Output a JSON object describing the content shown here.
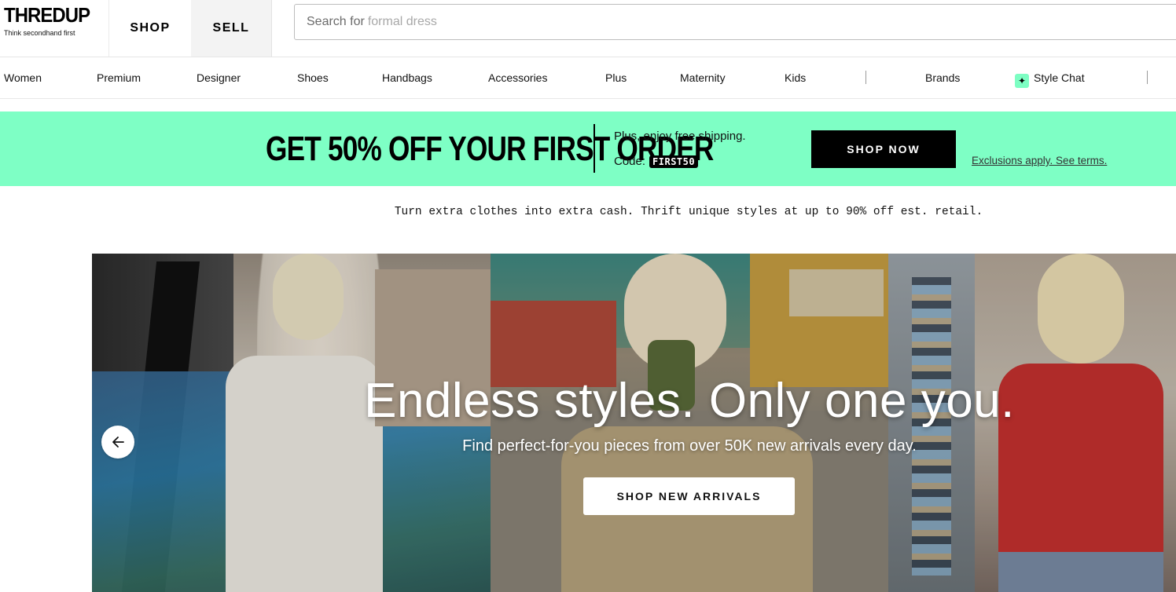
{
  "logo": {
    "word": "THREDUP",
    "tagline": "Think secondhand first"
  },
  "tabs": [
    {
      "label": "SHOP"
    },
    {
      "label": "SELL"
    }
  ],
  "search": {
    "prefix": "Search for",
    "suggestion": "formal dress"
  },
  "categories": [
    {
      "label": "Women"
    },
    {
      "label": "Premium"
    },
    {
      "label": "Designer"
    },
    {
      "label": "Shoes"
    },
    {
      "label": "Handbags"
    },
    {
      "label": "Accessories"
    },
    {
      "label": "Plus"
    },
    {
      "label": "Maternity"
    },
    {
      "label": "Kids"
    },
    {
      "label": "Brands"
    },
    {
      "label": "Style Chat",
      "icon": "sparkle-icon"
    }
  ],
  "promo": {
    "title": "GET 50% OFF YOUR FIRST ORDER",
    "subtitle": "Plus, enjoy free shipping.",
    "code_label": "Code:",
    "code": "FIRST50",
    "cta": "SHOP NOW",
    "terms": "Exclusions apply. See terms.",
    "background": "#7effc5"
  },
  "tagline": "Turn extra clothes into extra cash. Thrift unique styles at up to 90% off est. retail.",
  "hero": {
    "title": "Endless styles. Only one you.",
    "subtitle": "Find perfect-for-you pieces from over 50K new arrivals every day.",
    "cta": "SHOP NEW ARRIVALS",
    "prev_icon": "arrow-left-icon"
  }
}
